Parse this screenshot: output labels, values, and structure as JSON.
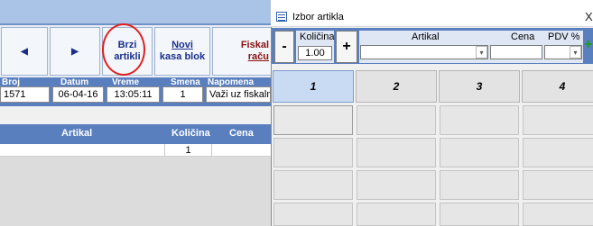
{
  "app": {
    "toolbar": {
      "prev_icon": "arrow-left-icon",
      "next_icon": "arrow-right-icon",
      "prev_glyph": "◀",
      "next_glyph": "▶",
      "quick_items_line1": "Brzi",
      "quick_items_line2": "artikli",
      "new_receipt_line1": "Novi",
      "new_receipt_line2": "kasa blok",
      "fiscal_line1": "Fiskal",
      "fiscal_line2": "raču"
    },
    "header": {
      "labels": [
        "Broj",
        "Datum",
        "Vreme",
        "Smena",
        "Napomena"
      ],
      "values": [
        "1571",
        "06-04-16",
        "13:05:11",
        "1",
        "Važi uz fiskalni"
      ]
    },
    "columns": [
      "Artikal",
      "Količina",
      "Cena"
    ],
    "rows": [
      {
        "artikal": "",
        "kolicina": "1",
        "cena": ""
      }
    ]
  },
  "popup": {
    "title": "Izbor artikla",
    "close_glyph": "X",
    "minus": "-",
    "plus": "+",
    "qty_label": "Količina",
    "qty_value": "1.00",
    "artikal_label": "Artikal",
    "cena_label": "Cena",
    "pdv_label": "PDV %",
    "add_glyph": "+",
    "categories": [
      "1",
      "2",
      "3",
      "4"
    ]
  },
  "colors": {
    "accent_blue": "#5a7fbf",
    "selected_tab": "#c9daf3",
    "highlight_circle": "#e02020",
    "add_green": "#1b9e1b"
  }
}
